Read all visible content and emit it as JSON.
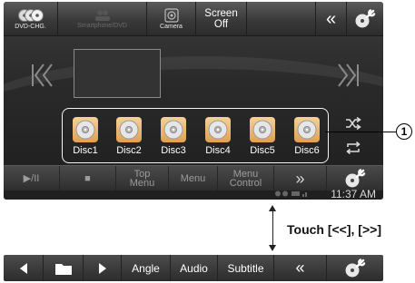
{
  "topbar": {
    "dvd_chg_label": "DVD-CHG.",
    "dim_label": "Smartphone/DVD",
    "camera_label": "Camera",
    "screen_line1": "Screen",
    "screen_line2": "Off",
    "back_glyph": "«"
  },
  "discs": [
    {
      "label": "Disc1"
    },
    {
      "label": "Disc2"
    },
    {
      "label": "Disc3"
    },
    {
      "label": "Disc4"
    },
    {
      "label": "Disc5"
    },
    {
      "label": "Disc6"
    }
  ],
  "controls": {
    "play_pause": "▶/II",
    "stop": "■",
    "top_menu_l1": "Top",
    "top_menu_l2": "Menu",
    "menu": "Menu",
    "menu_control_l1": "Menu",
    "menu_control_l2": "Control",
    "next_page": "»"
  },
  "status": {
    "time": "11:37 AM"
  },
  "callout": {
    "number": "1"
  },
  "instruction": {
    "text": "Touch [<<], [>>]"
  },
  "bar2": {
    "angle": "Angle",
    "audio": "Audio",
    "subtitle": "Subtitle",
    "back_glyph": "«"
  },
  "icons": {
    "skip_prev": "skip-previous-icon",
    "skip_next": "skip-next-icon",
    "shuffle": "shuffle-icon",
    "repeat": "repeat-icon",
    "settings": "disc-wrench-icon"
  }
}
